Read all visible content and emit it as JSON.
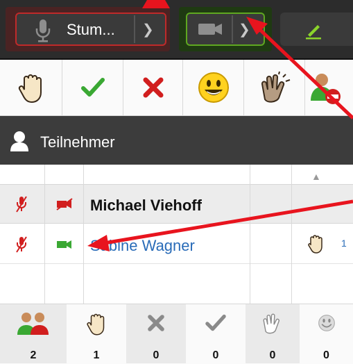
{
  "toolbar": {
    "mic_label": "Stum...",
    "mic_state": "muted",
    "camera_state": "on"
  },
  "reactions": [
    {
      "icon": "raise-hand-icon"
    },
    {
      "icon": "checkmark-icon"
    },
    {
      "icon": "cross-icon"
    },
    {
      "icon": "smiley-icon"
    },
    {
      "icon": "applause-icon"
    },
    {
      "icon": "leave-user-icon"
    }
  ],
  "participants": {
    "header_label": "Teilnehmer",
    "rows": [
      {
        "name": "Michael Viehoff",
        "mic": "muted",
        "camera": "off",
        "role": "host"
      },
      {
        "name": "Sabine Wagner",
        "mic": "muted",
        "camera": "on",
        "hand": "raised",
        "count": "1"
      }
    ]
  },
  "stats": [
    {
      "icon": "participants-icon",
      "value": "2"
    },
    {
      "icon": "raise-hand-icon",
      "value": "1"
    },
    {
      "icon": "cross-icon",
      "value": "0"
    },
    {
      "icon": "checkmark-icon",
      "value": "0"
    },
    {
      "icon": "applause-icon",
      "value": "0"
    },
    {
      "icon": "smiley-icon",
      "value": "0"
    }
  ],
  "colors": {
    "mic_border": "#c02a2a",
    "cam_border": "#5fa820",
    "link_blue": "#2a6cb8",
    "annotation_red": "#e8141e"
  }
}
